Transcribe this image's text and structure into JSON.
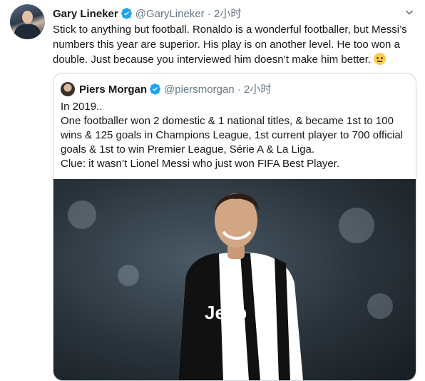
{
  "tweet": {
    "author_name": "Gary Lineker",
    "handle": "@GaryLineker",
    "separator": "·",
    "time": "2小时",
    "text": "Stick to anything but football. Ronaldo is a wonderful footballer, but Messi’s numbers this year are superior. His play is on another level. He too won a double. Just because you interviewed him doesn’t make him better."
  },
  "quoted": {
    "author_name": "Piers Morgan",
    "handle": "@piersmorgan",
    "separator": "·",
    "time": "2小时",
    "lines": [
      "In 2019..",
      "One footballer won 2 domestic & 1 national titles, & became 1st to 100 wins & 125 goals in Champions League, 1st current player to 700 official goals & 1st to win Premier League, Série A & La Liga.",
      "Clue: it wasn’t Lionel Messi who just won FIFA Best Player."
    ],
    "image_jersey_text": "Jeep"
  },
  "icons": {
    "verified": "verified-badge-icon",
    "menu": "chevron-down-icon",
    "emoji": "face-with-rolling-eyes-emoji"
  },
  "colors": {
    "verified": "#1da1f2",
    "meta": "#657786",
    "border": "#ccd6dd"
  }
}
